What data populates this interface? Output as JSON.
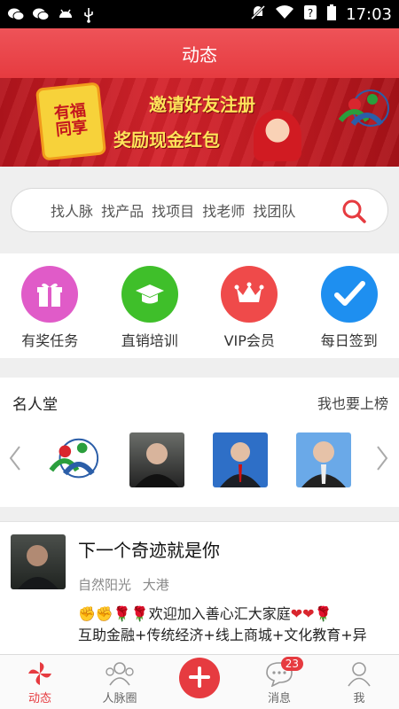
{
  "statusbar": {
    "time": "17:03"
  },
  "header": {
    "title": "动态"
  },
  "banner": {
    "badge_lines": [
      "有福",
      "同享"
    ],
    "line1": "邀请好友注册",
    "line2": "奖励现金红包"
  },
  "search": {
    "placeholder": "找人脉 找产品 找项目 找老师 找团队"
  },
  "quick_actions": [
    {
      "label": "有奖任务",
      "color": "#e05bc8"
    },
    {
      "label": "直销培训",
      "color": "#3fbf2a"
    },
    {
      "label": "VIP会员",
      "color": "#ef4a4a"
    },
    {
      "label": "每日签到",
      "color": "#1e8ff0"
    }
  ],
  "fame": {
    "title": "名人堂",
    "action": "我也要上榜"
  },
  "post": {
    "title": "下一个奇迹就是你",
    "author": "自然阳光",
    "location": "大港",
    "body_line1": "欢迎加入善心汇大家庭",
    "body_line2": "互助金融+传统经济+线上商城+文化教育+异"
  },
  "tabs": [
    {
      "label": "动态"
    },
    {
      "label": "人脉圈"
    },
    {
      "label": ""
    },
    {
      "label": "消息",
      "badge": "23"
    },
    {
      "label": "我"
    }
  ],
  "colors": {
    "accent": "#e63b40"
  }
}
